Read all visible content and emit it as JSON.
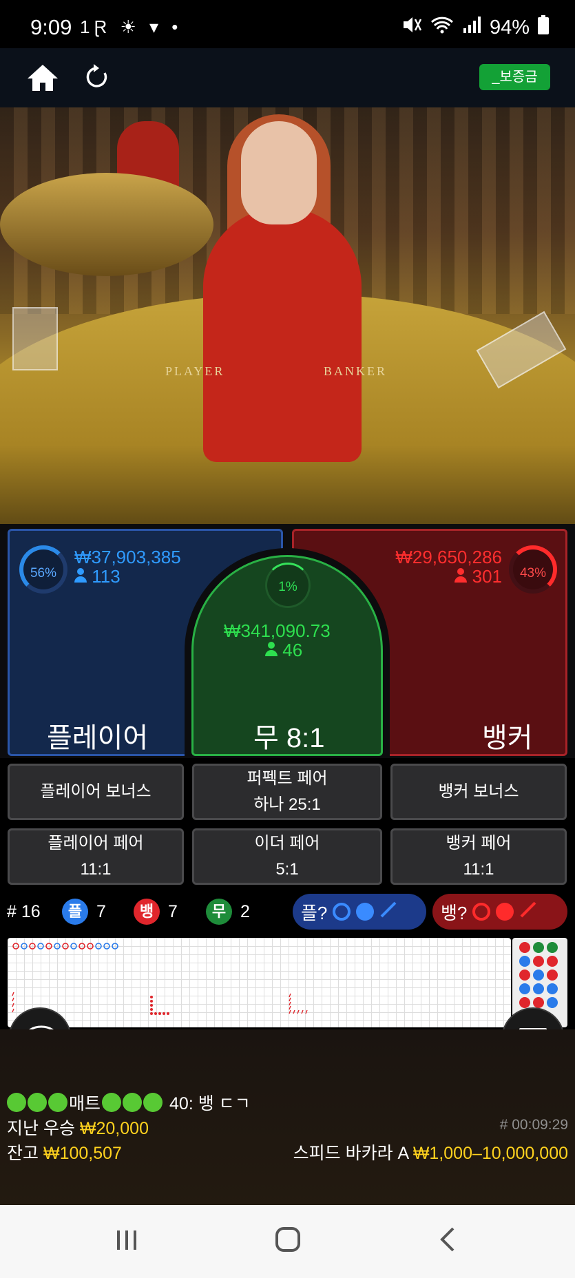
{
  "status_bar": {
    "time": "9:09",
    "left_icons": "1Ɽ ☀ ▾ •",
    "battery": "94%"
  },
  "header": {
    "home_icon": "home-icon",
    "refresh_icon": "refresh-icon",
    "deposit_label": "_보증금"
  },
  "video": {
    "player_label": "PLAYER",
    "banker_label": "BANKER"
  },
  "bets": {
    "player": {
      "percent": "56%",
      "amount": "₩37,903,385",
      "count": "113",
      "label": "플레이어"
    },
    "tie": {
      "percent": "1%",
      "amount": "₩341,090.73",
      "count": "46",
      "label": "무 8:1"
    },
    "banker": {
      "percent": "43%",
      "amount": "₩29,650,286",
      "count": "301",
      "label": "뱅커"
    }
  },
  "side_bets": [
    {
      "line1": "플레이어 보너스",
      "line2": ""
    },
    {
      "line1": "퍼펙트 페어",
      "line2": "하나 25:1"
    },
    {
      "line1": "뱅커 보너스",
      "line2": ""
    },
    {
      "line1": "플레이어 페어",
      "line2": "11:1"
    },
    {
      "line1": "이더 페어",
      "line2": "5:1"
    },
    {
      "line1": "뱅커 페어",
      "line2": "11:1"
    }
  ],
  "stats": {
    "round": "# 16",
    "player_badge": "플",
    "player_count": "7",
    "banker_badge": "뱅",
    "banker_count": "7",
    "tie_badge": "무",
    "tie_count": "2",
    "player_predict": "플?",
    "banker_predict": "뱅?"
  },
  "chat": {
    "message": "매트",
    "message_tail": "40: 뱅 ㄷㄱ"
  },
  "info": {
    "last_win_label": "지난 우승",
    "last_win_value": "₩20,000",
    "balance_label": "잔고",
    "balance_value": "₩100,507",
    "round_id": "# 00:09:29",
    "table_name": "스피드 바카라 A",
    "limits": "₩1,000–10,000,000"
  },
  "colors": {
    "player": "#2f9bff",
    "banker": "#ff2e2e",
    "tie": "#2ee04f",
    "gold": "#ffd21e",
    "deposit": "#13a136"
  }
}
